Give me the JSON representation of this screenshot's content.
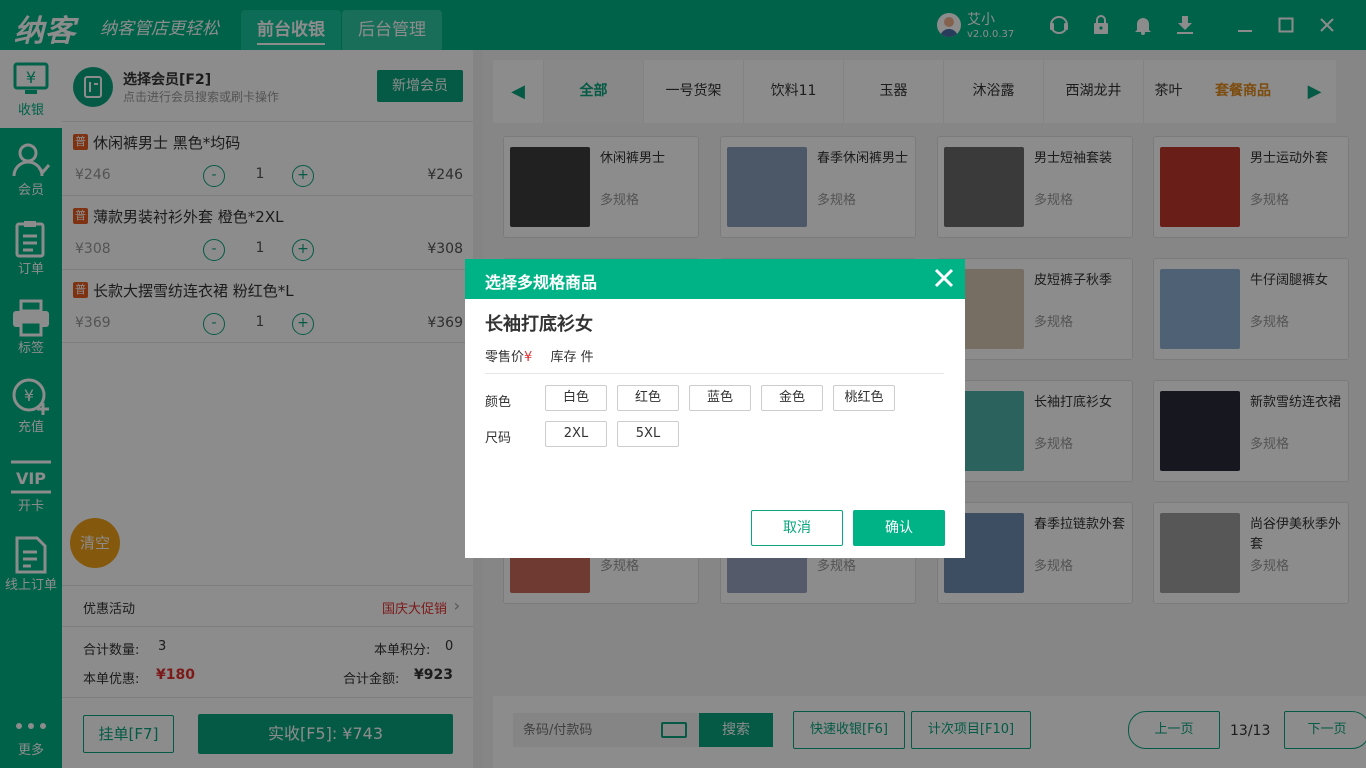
{
  "brand": {
    "logo": "纳客",
    "slogan": "纳客管店更轻松"
  },
  "header": {
    "tabs": [
      {
        "label": "前台收银",
        "active": true
      },
      {
        "label": "后台管理",
        "active": false
      }
    ],
    "user": {
      "name": "艾小",
      "version": "v2.0.0.37"
    },
    "icons": [
      "support-icon",
      "lock-icon",
      "bell-icon",
      "download-icon",
      "minimize-icon",
      "maximize-icon",
      "close-icon"
    ]
  },
  "sidebar": {
    "items": [
      {
        "label": "收银",
        "icon": "cashier-icon",
        "active": true
      },
      {
        "label": "会员",
        "icon": "member-icon"
      },
      {
        "label": "订单",
        "icon": "order-icon"
      },
      {
        "label": "标签",
        "icon": "printer-icon"
      },
      {
        "label": "充值",
        "icon": "recharge-icon"
      },
      {
        "label": "开卡",
        "icon": "vip-card-icon"
      },
      {
        "label": "线上订单",
        "icon": "online-order-icon"
      }
    ],
    "more_label": "更多"
  },
  "cart": {
    "member_title": "选择会员[F2]",
    "member_subtitle": "点击进行会员搜索或刷卡操作",
    "add_member_label": "新增会员",
    "items": [
      {
        "badge": "普",
        "name": "休闲裤男士 黑色*均码",
        "unit_price": "¥246",
        "qty": "1",
        "total": "¥246"
      },
      {
        "badge": "普",
        "name": "薄款男装衬衫外套 橙色*2XL",
        "unit_price": "¥308",
        "qty": "1",
        "total": "¥308"
      },
      {
        "badge": "普",
        "name": "长款大摆雪纺连衣裙 粉红色*L",
        "unit_price": "¥369",
        "qty": "1",
        "total": "¥369"
      }
    ],
    "minus": "-",
    "plus": "+",
    "clear_label": "清空",
    "promo_label": "优惠活动",
    "promo_value": "国庆大促销",
    "summary": {
      "count_label": "合计数量:",
      "count_value": "3",
      "points_label": "本单积分:",
      "points_value": "0",
      "discount_label": "本单优惠:",
      "discount_value": "¥180",
      "total_label": "合计金额:",
      "total_value": "¥923"
    },
    "hold_label": "挂单[F7]",
    "pay_label": "实收[F5]: ¥743"
  },
  "categories": {
    "items": [
      "全部",
      "一号货架",
      "饮料11",
      "玉器",
      "沐浴露",
      "西湖龙井",
      "茶叶"
    ],
    "combo": "套餐商品",
    "active": "全部"
  },
  "products": [
    {
      "name": "休闲裤男士",
      "tag": "多规格",
      "color": "#3d3d3d"
    },
    {
      "name": "春季休闲裤男士",
      "tag": "多规格",
      "color": "#8ba1bd"
    },
    {
      "name": "男士短袖套装",
      "tag": "多规格",
      "color": "#6b6b6b"
    },
    {
      "name": "男士运动外套",
      "tag": "多规格",
      "color": "#c0392b"
    },
    {
      "name": "",
      "tag": "",
      "color": "#cfcfcf"
    },
    {
      "name": "",
      "tag": "",
      "color": "#cfcfcf"
    },
    {
      "name": "皮短裤子秋季",
      "tag": "多规格",
      "color": "#d8c9b4"
    },
    {
      "name": "牛仔阔腿裤女",
      "tag": "多规格",
      "color": "#8fb1d6"
    },
    {
      "name": "",
      "tag": "",
      "color": "#cfcfcf"
    },
    {
      "name": "",
      "tag": "",
      "color": "#cfcfcf"
    },
    {
      "name": "长袖打底衫女",
      "tag": "多规格",
      "color": "#4fb3a9"
    },
    {
      "name": "新款雪纺连衣裙",
      "tag": "多规格",
      "color": "#2a2d3a"
    },
    {
      "name": "",
      "tag": "多规格",
      "color": "#c96b5c"
    },
    {
      "name": "",
      "tag": "多规格",
      "color": "#9aa4bf"
    },
    {
      "name": "春季拉链款外套",
      "tag": "多规格",
      "color": "#6f8fb5"
    },
    {
      "name": "尚谷伊美秋季外套",
      "tag": "多规格",
      "color": "#9e9e9e"
    }
  ],
  "bottom": {
    "search_placeholder": "条码/付款码",
    "search_label": "搜索",
    "quick_label": "快速收银[F6]",
    "count_label": "计次项目[F10]",
    "prev_label": "上一页",
    "page": "13/13",
    "next_label": "下一页"
  },
  "dialog": {
    "title": "选择多规格商品",
    "product": "长袖打底衫女",
    "retail_label": "零售价",
    "yen": "¥",
    "stock_label": "库存 件",
    "color_label": "颜色",
    "colors": [
      "白色",
      "红色",
      "蓝色",
      "金色",
      "桃红色"
    ],
    "size_label": "尺码",
    "sizes": [
      "2XL",
      "5XL"
    ],
    "cancel_label": "取消",
    "confirm_label": "确认"
  },
  "theme": {
    "primary": "#00b386",
    "accent_red": "#e23030",
    "orange": "#f0a21a"
  }
}
